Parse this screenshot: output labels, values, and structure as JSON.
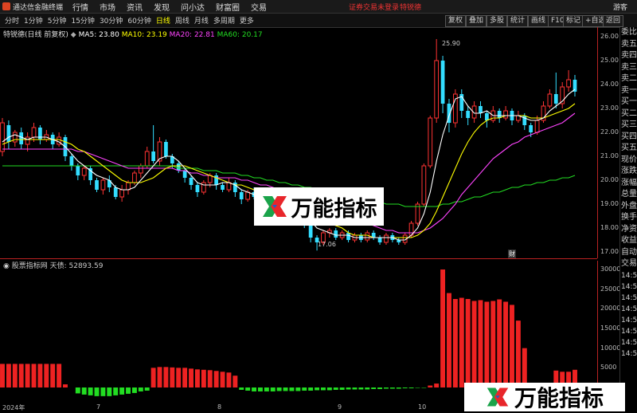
{
  "titlebar": {
    "app_name": "通达信金融终端",
    "menus": [
      "行情",
      "市场",
      "资讯",
      "发现",
      "问小达",
      "财富圈",
      "交易"
    ],
    "notice": "证券交易未登录",
    "notice2": "特锐德",
    "user": "游客"
  },
  "toolbar": {
    "periods": [
      "分时",
      "1分钟",
      "5分钟",
      "15分钟",
      "30分钟",
      "60分钟",
      "日线",
      "周线",
      "月线",
      "多周期",
      "更多"
    ],
    "active_period": "日线",
    "buttons": [
      "复权",
      "叠加",
      "多股",
      "统计",
      "画线",
      "F10",
      "标记",
      "+自选",
      "返回"
    ]
  },
  "info": {
    "stock": "特锐德(日线 前复权)",
    "ma5_label": "MA5: 23.80",
    "ma10_label": "MA10: 23.19",
    "ma20_label": "MA20: 22.81",
    "ma60_label": "MA60: 20.17",
    "colors": {
      "ma5": "#ffffff",
      "ma10": "#ffff00",
      "ma20": "#ff44ff",
      "ma60": "#22dd22"
    }
  },
  "price_axis": [
    "26.00",
    "25.00",
    "24.00",
    "23.00",
    "22.00",
    "21.00",
    "20.00",
    "19.00",
    "18.00",
    "17.00"
  ],
  "vol_axis": [
    "30000",
    "25000",
    "20000",
    "15000",
    "10000",
    "5000"
  ],
  "vol_panel": {
    "title": "股票指标网 天债: 52893.59"
  },
  "annotations": {
    "high": "25.90",
    "low": "17.06",
    "mark_label": "财"
  },
  "sidebar": [
    "委比",
    "卖五",
    "卖四",
    "卖三",
    "卖二",
    "卖一",
    "买一",
    "买二",
    "买三",
    "买四",
    "买五",
    "现价",
    "涨跌",
    "涨幅",
    "总量",
    "外盘",
    "换手",
    "净资",
    "收益",
    "自动",
    "交易"
  ],
  "sidebar_small": [
    "14:5",
    "14:5",
    "14:5",
    "14:5",
    "14:5",
    "14:5",
    "14:5",
    "14:5"
  ],
  "xaxis": {
    "labels": [
      "2024年",
      "7",
      "8",
      "9",
      "10"
    ]
  },
  "watermark": {
    "text": "万能指标"
  },
  "chart_data": {
    "type": "candlestick",
    "ylim": [
      16.8,
      26.2
    ],
    "candles": [
      [
        21.2,
        22.4,
        22.6,
        21.0
      ],
      [
        22.3,
        21.6,
        22.5,
        21.3
      ],
      [
        21.6,
        22.0,
        22.1,
        21.4
      ],
      [
        22.0,
        21.5,
        22.2,
        21.3
      ],
      [
        21.5,
        21.8,
        22.0,
        21.2
      ],
      [
        21.8,
        22.2,
        22.4,
        21.6
      ],
      [
        22.2,
        21.7,
        22.3,
        21.5
      ],
      [
        21.7,
        21.9,
        22.1,
        21.6
      ],
      [
        21.9,
        21.5,
        22.0,
        21.3
      ],
      [
        21.5,
        21.8,
        22.0,
        21.4
      ],
      [
        21.8,
        21.0,
        21.9,
        20.8
      ],
      [
        21.0,
        20.6,
        21.1,
        20.4
      ],
      [
        20.6,
        20.2,
        20.7,
        20.0
      ],
      [
        20.2,
        20.5,
        20.6,
        20.0
      ],
      [
        20.5,
        20.0,
        20.6,
        19.8
      ],
      [
        20.0,
        19.6,
        20.1,
        19.5
      ],
      [
        19.6,
        20.0,
        20.1,
        19.4
      ],
      [
        20.0,
        19.7,
        20.2,
        19.5
      ],
      [
        19.7,
        19.3,
        19.8,
        19.2
      ],
      [
        19.3,
        19.6,
        19.8,
        19.1
      ],
      [
        19.6,
        19.9,
        20.0,
        19.4
      ],
      [
        19.9,
        20.3,
        20.4,
        19.8
      ],
      [
        20.3,
        20.6,
        20.7,
        20.1
      ],
      [
        20.6,
        21.2,
        21.4,
        20.5
      ],
      [
        21.2,
        20.8,
        22.3,
        20.7
      ],
      [
        20.8,
        21.6,
        21.8,
        20.6
      ],
      [
        21.6,
        21.0,
        21.7,
        20.9
      ],
      [
        21.0,
        20.7,
        21.1,
        20.5
      ],
      [
        20.7,
        20.4,
        20.8,
        20.3
      ],
      [
        20.4,
        20.1,
        20.5,
        19.9
      ],
      [
        20.1,
        19.8,
        20.2,
        19.6
      ],
      [
        19.8,
        19.5,
        19.9,
        19.3
      ],
      [
        19.5,
        19.9,
        20.0,
        19.4
      ],
      [
        19.9,
        20.2,
        20.3,
        19.7
      ],
      [
        20.2,
        19.8,
        20.3,
        19.6
      ],
      [
        19.8,
        19.6,
        19.9,
        19.5
      ],
      [
        19.6,
        19.9,
        20.1,
        19.5
      ],
      [
        19.9,
        19.5,
        20.0,
        19.3
      ],
      [
        19.5,
        19.2,
        19.6,
        19.0
      ],
      [
        19.2,
        19.5,
        19.6,
        19.1
      ],
      [
        19.5,
        19.3,
        19.7,
        19.2
      ],
      [
        19.3,
        19.1,
        19.4,
        18.9
      ],
      [
        19.1,
        19.3,
        19.5,
        19.0
      ],
      [
        19.3,
        19.0,
        19.4,
        18.8
      ],
      [
        19.0,
        18.7,
        19.1,
        18.5
      ],
      [
        18.7,
        18.9,
        19.0,
        18.6
      ],
      [
        18.9,
        18.6,
        19.0,
        18.5
      ],
      [
        18.6,
        18.4,
        18.7,
        18.3
      ],
      [
        18.4,
        18.2,
        18.5,
        18.0
      ],
      [
        18.2,
        17.6,
        18.3,
        17.4
      ],
      [
        17.6,
        17.4,
        17.7,
        17.06
      ],
      [
        17.4,
        17.8,
        17.9,
        17.3
      ],
      [
        17.8,
        17.9,
        18.0,
        17.6
      ],
      [
        17.9,
        17.6,
        18.0,
        17.5
      ],
      [
        17.6,
        17.8,
        17.9,
        17.5
      ],
      [
        17.8,
        17.5,
        17.9,
        17.4
      ],
      [
        17.5,
        17.7,
        17.8,
        17.4
      ],
      [
        17.7,
        17.5,
        17.8,
        17.4
      ],
      [
        17.5,
        17.8,
        17.9,
        17.4
      ],
      [
        17.8,
        17.6,
        17.9,
        17.5
      ],
      [
        17.6,
        17.4,
        17.7,
        17.3
      ],
      [
        17.4,
        17.7,
        17.8,
        17.3
      ],
      [
        17.7,
        17.5,
        17.8,
        17.4
      ],
      [
        17.5,
        17.4,
        17.6,
        17.3
      ],
      [
        17.4,
        17.7,
        17.8,
        17.3
      ],
      [
        17.7,
        18.2,
        18.3,
        17.6
      ],
      [
        18.2,
        19.0,
        19.1,
        18.1
      ],
      [
        19.0,
        20.6,
        20.7,
        18.9
      ],
      [
        20.6,
        22.6,
        22.7,
        20.5
      ],
      [
        22.6,
        25.0,
        25.9,
        22.4
      ],
      [
        25.0,
        23.2,
        25.2,
        22.8
      ],
      [
        23.2,
        22.4,
        23.4,
        22.0
      ],
      [
        22.4,
        23.6,
        23.8,
        22.2
      ],
      [
        23.6,
        22.9,
        23.8,
        22.6
      ],
      [
        22.9,
        22.6,
        23.1,
        22.3
      ],
      [
        22.6,
        23.1,
        23.3,
        22.4
      ],
      [
        23.1,
        22.8,
        23.3,
        22.6
      ],
      [
        22.8,
        22.5,
        22.9,
        22.2
      ],
      [
        22.5,
        22.9,
        23.1,
        22.4
      ],
      [
        22.9,
        22.6,
        23.0,
        22.4
      ],
      [
        22.6,
        22.9,
        23.1,
        22.5
      ],
      [
        22.9,
        22.5,
        23.0,
        22.3
      ],
      [
        22.5,
        22.7,
        22.9,
        22.4
      ],
      [
        22.7,
        22.3,
        22.8,
        22.1
      ],
      [
        22.3,
        22.0,
        22.4,
        21.8
      ],
      [
        22.0,
        22.5,
        22.7,
        21.9
      ],
      [
        22.5,
        23.1,
        23.3,
        22.4
      ],
      [
        23.1,
        23.6,
        23.8,
        23.0
      ],
      [
        23.6,
        23.2,
        24.5,
        23.0
      ],
      [
        23.2,
        23.9,
        24.1,
        23.0
      ],
      [
        23.9,
        24.2,
        24.6,
        23.7
      ],
      [
        24.2,
        23.7,
        24.4,
        23.5
      ]
    ],
    "ma5": [
      21.6,
      21.8,
      21.9,
      21.8,
      21.7,
      21.8,
      21.8,
      21.8,
      21.7,
      21.6,
      21.4,
      21.1,
      20.8,
      20.6,
      20.4,
      20.2,
      20.1,
      20.0,
      19.7,
      19.6,
      19.6,
      19.7,
      20.0,
      20.3,
      20.6,
      20.9,
      21.0,
      21.0,
      20.8,
      20.5,
      20.2,
      19.9,
      19.8,
      19.8,
      19.8,
      19.9,
      19.9,
      19.8,
      19.6,
      19.5,
      19.4,
      19.3,
      19.3,
      19.2,
      19.1,
      19.0,
      18.8,
      18.7,
      18.5,
      18.3,
      18.0,
      17.9,
      17.8,
      17.7,
      17.7,
      17.7,
      17.6,
      17.6,
      17.6,
      17.6,
      17.6,
      17.6,
      17.6,
      17.5,
      17.5,
      17.7,
      18.0,
      18.6,
      19.5,
      20.8,
      21.9,
      22.7,
      23.4,
      23.5,
      23.1,
      22.8,
      22.8,
      22.9,
      22.7,
      22.7,
      22.7,
      22.7,
      22.7,
      22.6,
      22.5,
      22.5,
      22.6,
      22.9,
      23.1,
      23.3,
      23.6,
      23.8
    ],
    "ma10": [
      21.5,
      21.6,
      21.7,
      21.7,
      21.7,
      21.7,
      21.7,
      21.7,
      21.7,
      21.7,
      21.6,
      21.5,
      21.3,
      21.2,
      21.0,
      20.8,
      20.6,
      20.4,
      20.2,
      20.0,
      19.9,
      19.9,
      19.9,
      20.0,
      20.1,
      20.3,
      20.5,
      20.6,
      20.6,
      20.6,
      20.5,
      20.4,
      20.3,
      20.2,
      20.1,
      20.0,
      19.9,
      19.8,
      19.8,
      19.7,
      19.6,
      19.5,
      19.4,
      19.4,
      19.3,
      19.2,
      19.1,
      19.0,
      18.9,
      18.7,
      18.5,
      18.4,
      18.2,
      18.1,
      18.0,
      17.8,
      17.7,
      17.7,
      17.7,
      17.6,
      17.6,
      17.6,
      17.6,
      17.6,
      17.6,
      17.6,
      17.7,
      17.9,
      18.2,
      18.7,
      19.3,
      19.9,
      20.5,
      21.1,
      21.6,
      22.0,
      22.3,
      22.5,
      22.6,
      22.6,
      22.7,
      22.7,
      22.7,
      22.7,
      22.6,
      22.6,
      22.6,
      22.7,
      22.8,
      22.9,
      23.0,
      23.2
    ],
    "ma20": [
      21.3,
      21.3,
      21.3,
      21.3,
      21.3,
      21.3,
      21.3,
      21.3,
      21.3,
      21.3,
      21.3,
      21.3,
      21.2,
      21.2,
      21.1,
      21.0,
      20.9,
      20.8,
      20.7,
      20.6,
      20.5,
      20.5,
      20.5,
      20.5,
      20.5,
      20.5,
      20.5,
      20.5,
      20.4,
      20.4,
      20.3,
      20.3,
      20.2,
      20.2,
      20.1,
      20.1,
      20.1,
      20.1,
      20.0,
      20.0,
      19.9,
      19.8,
      19.8,
      19.7,
      19.6,
      19.5,
      19.4,
      19.3,
      19.2,
      19.1,
      19.0,
      18.9,
      18.8,
      18.7,
      18.6,
      18.5,
      18.4,
      18.3,
      18.2,
      18.1,
      18.0,
      17.9,
      17.9,
      17.8,
      17.8,
      17.8,
      17.8,
      17.9,
      18.0,
      18.2,
      18.4,
      18.7,
      19.0,
      19.4,
      19.7,
      20.0,
      20.3,
      20.6,
      20.9,
      21.1,
      21.3,
      21.5,
      21.6,
      21.8,
      21.9,
      22.0,
      22.1,
      22.2,
      22.3,
      22.4,
      22.6,
      22.8
    ],
    "ma60": [
      20.6,
      20.6,
      20.6,
      20.6,
      20.6,
      20.6,
      20.6,
      20.6,
      20.6,
      20.6,
      20.6,
      20.6,
      20.6,
      20.6,
      20.6,
      20.6,
      20.6,
      20.6,
      20.6,
      20.6,
      20.6,
      20.6,
      20.6,
      20.6,
      20.6,
      20.6,
      20.6,
      20.6,
      20.5,
      20.5,
      20.5,
      20.5,
      20.4,
      20.4,
      20.4,
      20.3,
      20.3,
      20.3,
      20.2,
      20.2,
      20.1,
      20.1,
      20.0,
      20.0,
      19.9,
      19.9,
      19.8,
      19.8,
      19.7,
      19.7,
      19.6,
      19.5,
      19.5,
      19.4,
      19.4,
      19.3,
      19.3,
      19.2,
      19.2,
      19.1,
      19.1,
      19.0,
      19.0,
      19.0,
      18.9,
      18.9,
      18.9,
      18.9,
      18.9,
      18.9,
      19.0,
      19.0,
      19.1,
      19.1,
      19.2,
      19.3,
      19.3,
      19.4,
      19.5,
      19.5,
      19.6,
      19.7,
      19.7,
      19.8,
      19.8,
      19.9,
      19.9,
      20.0,
      20.0,
      20.1,
      20.1,
      20.2
    ],
    "volume": {
      "ylim": [
        -3000,
        31000
      ],
      "values": [
        6000,
        6000,
        6000,
        6000,
        6000,
        6000,
        6000,
        6000,
        6000,
        6000,
        800,
        0,
        -1500,
        -1800,
        -2000,
        -2200,
        -2200,
        -2200,
        -2000,
        -1800,
        -1600,
        -1400,
        -1000,
        -800,
        5000,
        5200,
        5200,
        5100,
        5000,
        5000,
        4800,
        4600,
        4500,
        4400,
        4200,
        4000,
        3800,
        3000,
        -600,
        -800,
        -1000,
        -1000,
        -1000,
        -1000,
        -900,
        -900,
        -900,
        -900,
        -800,
        -800,
        -700,
        -700,
        -700,
        -600,
        -600,
        -500,
        -500,
        -500,
        -500,
        -400,
        -400,
        -300,
        -300,
        -300,
        -200,
        -200,
        -100,
        -100,
        500,
        1000,
        30000,
        24000,
        22500,
        22800,
        22500,
        22000,
        22200,
        21800,
        22000,
        22400,
        21800,
        21000,
        17000,
        10000,
        0,
        0,
        0,
        0,
        4300,
        4000,
        4000,
        4500
      ]
    }
  }
}
